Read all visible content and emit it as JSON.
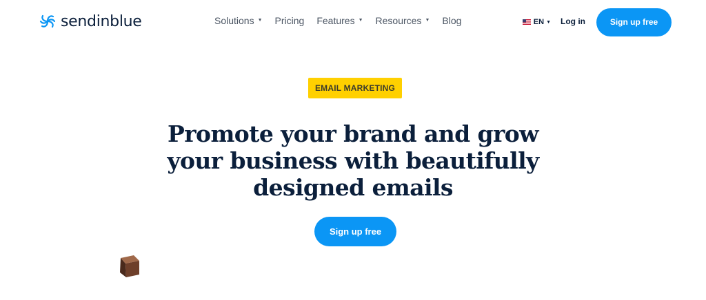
{
  "brand": {
    "name": "sendinblue"
  },
  "nav": {
    "items": [
      {
        "label": "Solutions",
        "dropdown": true
      },
      {
        "label": "Pricing",
        "dropdown": false
      },
      {
        "label": "Features",
        "dropdown": true
      },
      {
        "label": "Resources",
        "dropdown": true
      },
      {
        "label": "Blog",
        "dropdown": false
      }
    ],
    "language": "EN",
    "login_label": "Log in",
    "signup_label": "Sign up free"
  },
  "hero": {
    "badge": "EMAIL MARKETING",
    "headline": "Promote your brand and grow your business with beautifully designed emails",
    "cta_label": "Sign up free"
  },
  "colors": {
    "accent": "#0b96f5",
    "badge": "#ffd000",
    "text": "#0b1f3b"
  },
  "icons": {
    "logo": "sendinblue-swirl-icon",
    "flag": "us-flag-icon",
    "caret": "caret-down-icon",
    "decoration": "brown-cube-icon"
  }
}
